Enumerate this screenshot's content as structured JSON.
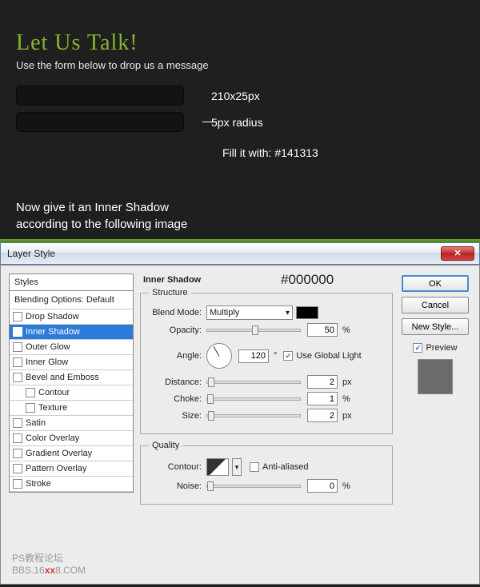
{
  "top": {
    "heading": "Let Us Talk!",
    "subheading": "Use the form below to drop us a message",
    "dim_label": "210x25px",
    "radius_label": "5px radius",
    "fill_label": "Fill it with: #141313",
    "instruction_l1": "Now give it an Inner Shadow",
    "instruction_l2": "according to the following image"
  },
  "dialog": {
    "title": "Layer Style",
    "close": "✕",
    "styles_header": "Styles",
    "blending_label": "Blending Options: Default",
    "effects": {
      "drop_shadow": "Drop Shadow",
      "inner_shadow": "Inner Shadow",
      "outer_glow": "Outer Glow",
      "inner_glow": "Inner Glow",
      "bevel": "Bevel and Emboss",
      "contour": "Contour",
      "texture": "Texture",
      "satin": "Satin",
      "color_overlay": "Color Overlay",
      "gradient_overlay": "Gradient Overlay",
      "pattern_overlay": "Pattern Overlay",
      "stroke": "Stroke"
    },
    "panel_title": "Inner Shadow",
    "hex_annotation": "#000000",
    "structure": {
      "legend": "Structure",
      "blend_mode_lbl": "Blend Mode:",
      "blend_mode_val": "Multiply",
      "opacity_lbl": "Opacity:",
      "opacity_val": "50",
      "angle_lbl": "Angle:",
      "angle_val": "120",
      "angle_deg": "°",
      "global_light": "Use Global Light",
      "distance_lbl": "Distance:",
      "distance_val": "2",
      "choke_lbl": "Choke:",
      "choke_val": "1",
      "size_lbl": "Size:",
      "size_val": "2",
      "px": "px",
      "pct": "%"
    },
    "quality": {
      "legend": "Quality",
      "contour_lbl": "Contour:",
      "anti_aliased": "Anti-aliased",
      "noise_lbl": "Noise:",
      "noise_val": "0",
      "pct": "%"
    },
    "buttons": {
      "ok": "OK",
      "cancel": "Cancel",
      "new_style": "New Style...",
      "preview": "Preview"
    }
  },
  "watermark": {
    "l1": "PS教程论坛",
    "l2a": "BBS.16",
    "l2b": "xx",
    "l2c": "8.COM"
  }
}
